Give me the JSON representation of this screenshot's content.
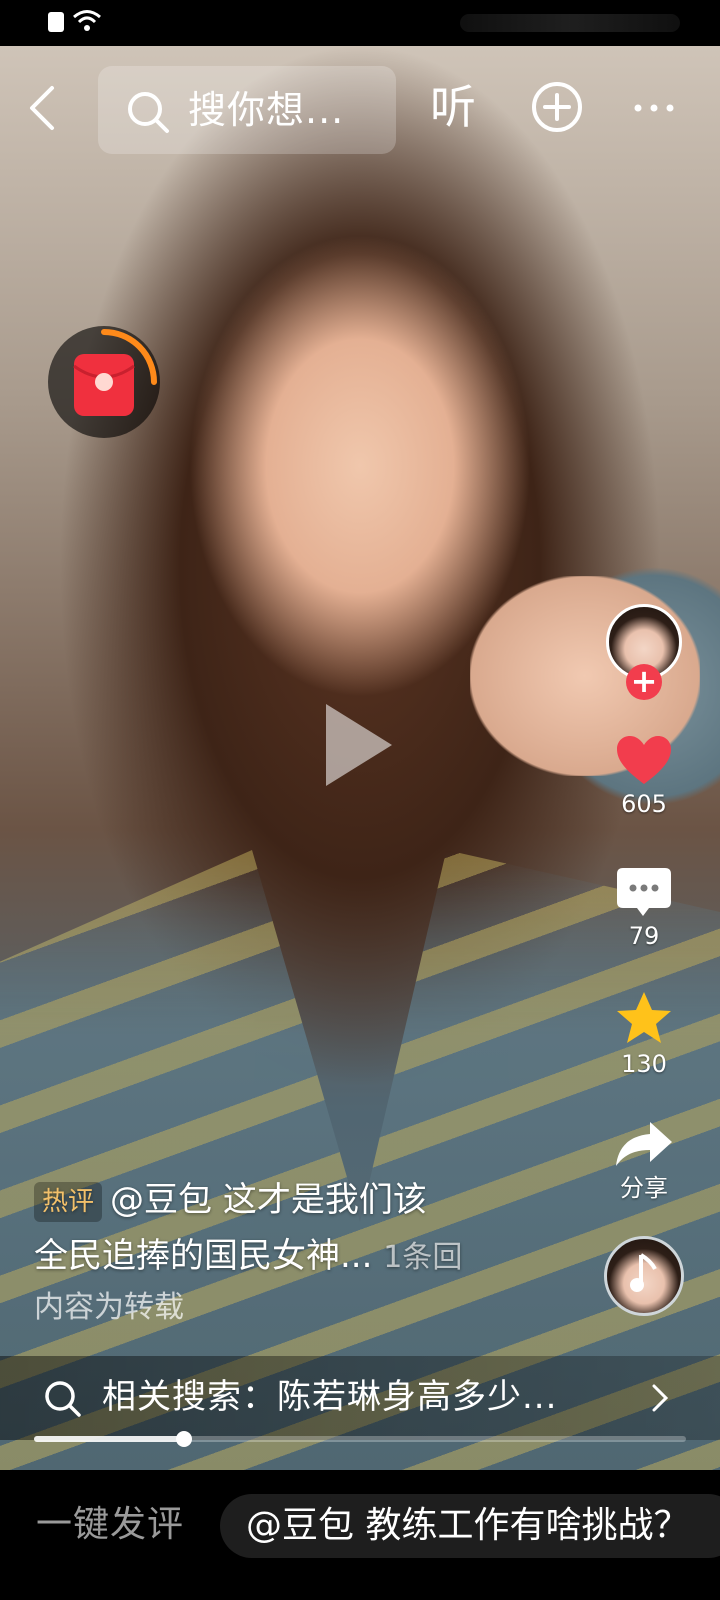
{
  "top_bar": {
    "search_placeholder": "搜你想...",
    "listen_label": "听",
    "icons": [
      "back-icon",
      "search-icon",
      "add-icon",
      "more-icon"
    ]
  },
  "side_rail": {
    "likes": "605",
    "comments": "79",
    "favorites": "130",
    "share_label": "分享"
  },
  "caption": {
    "hot_tag": "热评",
    "comment_line1": "@豆包 这才是我们该",
    "comment_line2": "全民追捧的国民女神...",
    "reply_count": "1条回",
    "repost_note": "内容为转载"
  },
  "related_search": {
    "text": "相关搜索：陈若琳身高多少..."
  },
  "progress": {
    "fraction": 0.23
  },
  "bottom_bar": {
    "quick_comment_label": "一键发评",
    "suggestion": "@豆包 教练工作有啥挑战？"
  },
  "colors": {
    "like_red": "#f23d4d",
    "favorite_yellow": "#ffc21a",
    "hot_tag": "#f2c06a"
  }
}
